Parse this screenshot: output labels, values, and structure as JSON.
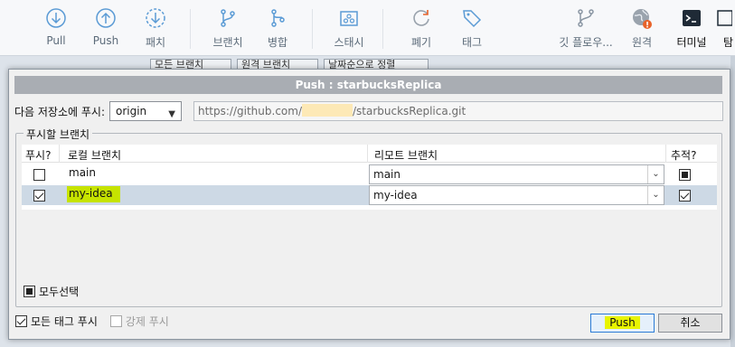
{
  "toolbar": {
    "items": [
      {
        "label": "Pull",
        "icon": "pull-icon"
      },
      {
        "label": "Push",
        "icon": "push-icon"
      },
      {
        "label": "패치",
        "icon": "fetch-icon"
      },
      {
        "label": "브랜치",
        "icon": "branch-icon"
      },
      {
        "label": "병합",
        "icon": "merge-icon"
      },
      {
        "label": "스태시",
        "icon": "stash-icon"
      },
      {
        "label": "폐기",
        "icon": "discard-icon"
      },
      {
        "label": "태그",
        "icon": "tag-icon"
      },
      {
        "label": "깃 플로우...",
        "icon": "git-flow-icon"
      },
      {
        "label": "원격",
        "icon": "remote-icon",
        "badge": "!"
      },
      {
        "label": "터미널",
        "icon": "terminal-icon"
      },
      {
        "label": "탐",
        "icon": "explorer-icon"
      }
    ],
    "colors": {
      "icon": "#5b9bd5",
      "badge": "#e8632a"
    }
  },
  "background": {
    "filter_branch": "모든 브랜치",
    "filter_remote": "원격 브랜치",
    "sort": "날짜순으로 정렬"
  },
  "dialog": {
    "title": "Push :  starbucksReplica",
    "dest_label": "다음 저장소에 푸시:",
    "remote_select": "origin",
    "url_prefix": "https://github.com/",
    "url_suffix": "/starbucksReplica.git",
    "group_title": "푸시할 브랜치",
    "headers": {
      "push": "푸시?",
      "local": "로컬 브랜치",
      "remote": "리모트 브랜치",
      "track": "추적?"
    },
    "rows": [
      {
        "push": false,
        "local": "main",
        "remote": "main",
        "track": "filled",
        "selected": false
      },
      {
        "push": true,
        "local": "my-idea",
        "remote": "my-idea",
        "track": "checked",
        "selected": true
      }
    ],
    "select_all": "모두선택",
    "push_all_tags": "모든 태그 푸시",
    "force_push": "강제 푸시",
    "push_button": "Push",
    "cancel_button": "취소"
  }
}
